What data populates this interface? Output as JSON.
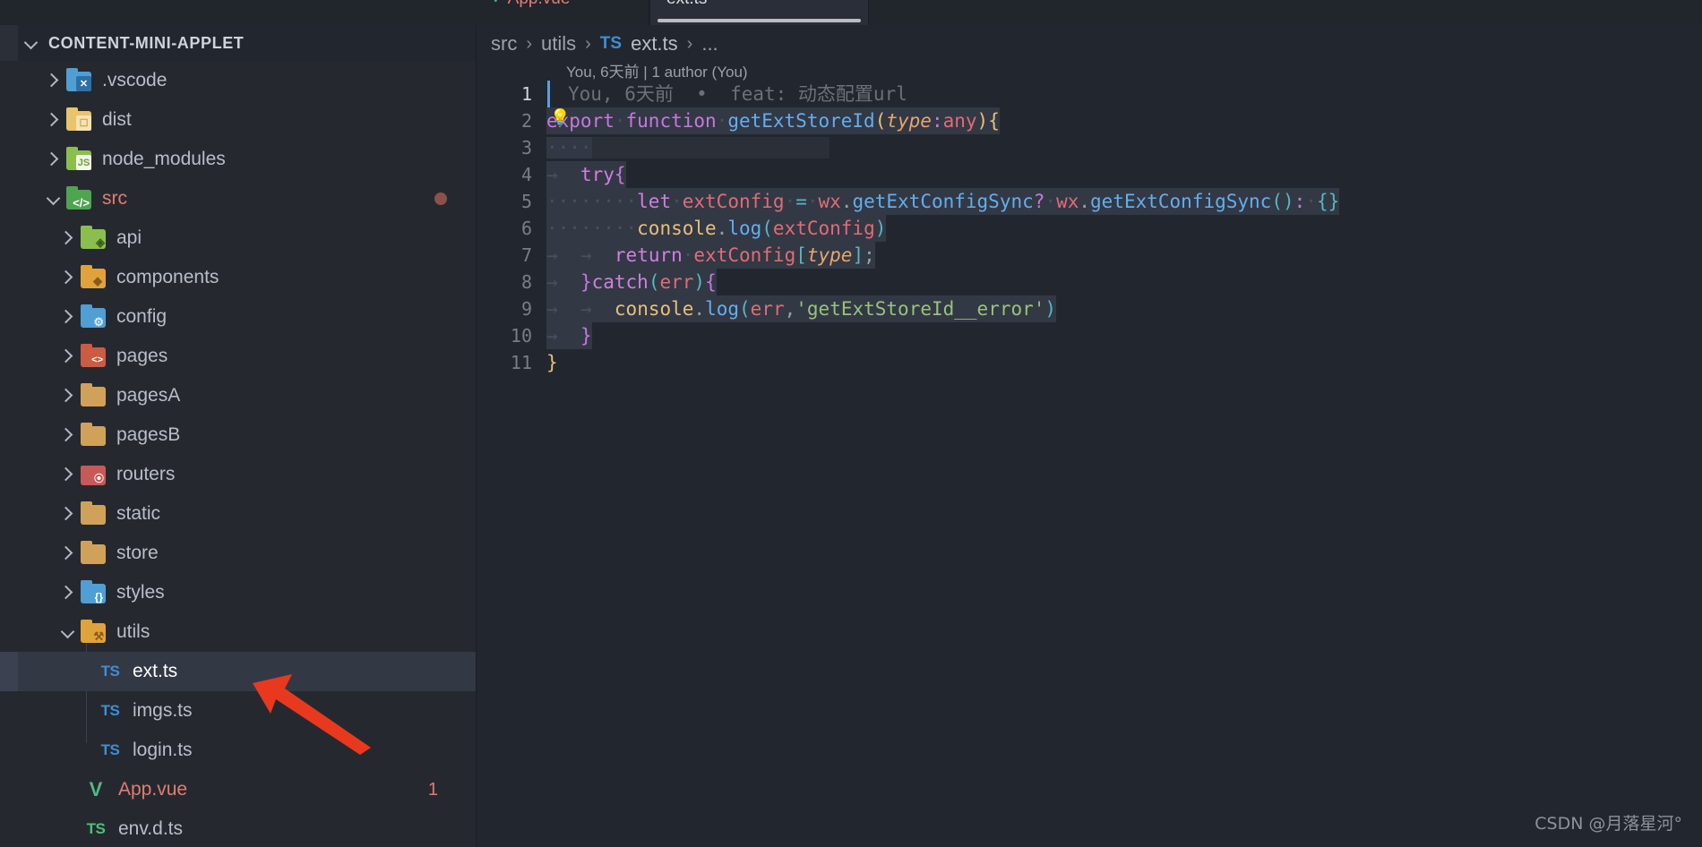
{
  "window": {
    "app": "vscode-editor"
  },
  "tabs": [
    {
      "label": "",
      "state": "partial"
    },
    {
      "label": "App.vue",
      "icon": "vue-icon",
      "state": "inactive"
    },
    {
      "label": "ext.ts",
      "icon": "typescript-icon",
      "state": "active"
    }
  ],
  "sidebar": {
    "section_title": "CONTENT-MINI-APPLET",
    "items": [
      {
        "label": ".vscode",
        "type": "folder",
        "icon": "folder-vscode-icon",
        "indent": 1,
        "expanded": false
      },
      {
        "label": "dist",
        "type": "folder",
        "icon": "folder-dist-icon",
        "indent": 1,
        "expanded": false
      },
      {
        "label": "node_modules",
        "type": "folder",
        "icon": "folder-node-icon",
        "indent": 1,
        "expanded": false
      },
      {
        "label": "src",
        "type": "folder",
        "icon": "folder-src-icon",
        "indent": 1,
        "expanded": true,
        "modified": true,
        "badge_dot": true
      },
      {
        "label": "api",
        "type": "folder",
        "icon": "folder-api-icon",
        "indent": 2,
        "expanded": false
      },
      {
        "label": "components",
        "type": "folder",
        "icon": "folder-components-icon",
        "indent": 2,
        "expanded": false
      },
      {
        "label": "config",
        "type": "folder",
        "icon": "folder-config-icon",
        "indent": 2,
        "expanded": false
      },
      {
        "label": "pages",
        "type": "folder",
        "icon": "folder-pages-icon",
        "indent": 2,
        "expanded": false
      },
      {
        "label": "pagesA",
        "type": "folder",
        "icon": "folder-icon",
        "indent": 2,
        "expanded": false
      },
      {
        "label": "pagesB",
        "type": "folder",
        "icon": "folder-icon",
        "indent": 2,
        "expanded": false
      },
      {
        "label": "routers",
        "type": "folder",
        "icon": "folder-routers-icon",
        "indent": 2,
        "expanded": false
      },
      {
        "label": "static",
        "type": "folder",
        "icon": "folder-icon",
        "indent": 2,
        "expanded": false
      },
      {
        "label": "store",
        "type": "folder",
        "icon": "folder-icon",
        "indent": 2,
        "expanded": false
      },
      {
        "label": "styles",
        "type": "folder",
        "icon": "folder-styles-icon",
        "indent": 2,
        "expanded": false
      },
      {
        "label": "utils",
        "type": "folder",
        "icon": "folder-utils-icon",
        "indent": 2,
        "expanded": true
      },
      {
        "label": "ext.ts",
        "type": "file",
        "icon": "typescript-icon",
        "indent": 3,
        "selected": true
      },
      {
        "label": "imgs.ts",
        "type": "file",
        "icon": "typescript-icon",
        "indent": 3
      },
      {
        "label": "login.ts",
        "type": "file",
        "icon": "typescript-icon",
        "indent": 3
      },
      {
        "label": "App.vue",
        "type": "file",
        "icon": "vue-icon",
        "indent": 2,
        "modified": true,
        "badge": "1"
      },
      {
        "label": "env.d.ts",
        "type": "file",
        "icon": "typescript-dts-icon",
        "indent": 2
      }
    ]
  },
  "breadcrumb": {
    "parts": [
      "src",
      "utils",
      "ext.ts",
      "..."
    ],
    "separator": "›",
    "file_icon_label": "TS"
  },
  "blame": {
    "header": "You, 6天前 | 1 author (You)",
    "inline": "You, 6天前  •  feat: 动态配置url"
  },
  "editor": {
    "filename": "ext.ts",
    "language": "typescript",
    "total_lines": 11,
    "cursor_line": 1,
    "lightbulb": "💡",
    "lines": [
      {
        "no": "1",
        "text": ""
      },
      {
        "no": "2",
        "text": "export function getExtStoreId(type:any){"
      },
      {
        "no": "3",
        "text": ""
      },
      {
        "no": "4",
        "text": "  try{"
      },
      {
        "no": "5",
        "text": "    let extConfig = wx.getExtConfigSync? wx.getExtConfigSync(): {}"
      },
      {
        "no": "6",
        "text": "    console.log(extConfig)"
      },
      {
        "no": "7",
        "text": "    return extConfig[type];"
      },
      {
        "no": "8",
        "text": "  }catch(err){"
      },
      {
        "no": "9",
        "text": "    console.log(err,'getExtStoreId__error')"
      },
      {
        "no": "10",
        "text": "  }"
      },
      {
        "no": "11",
        "text": "}"
      }
    ]
  },
  "annotation": {
    "arrow": "red-pointer-arrow",
    "points_to": "ext.ts"
  },
  "watermark": "CSDN @月落星河°",
  "colors": {
    "background": "#22262e",
    "sidebar": "#25292f",
    "selection": "#333845",
    "accent_blue": "#3d8fd6",
    "modified": "#e27c71",
    "arrow_red": "#e8391e"
  }
}
